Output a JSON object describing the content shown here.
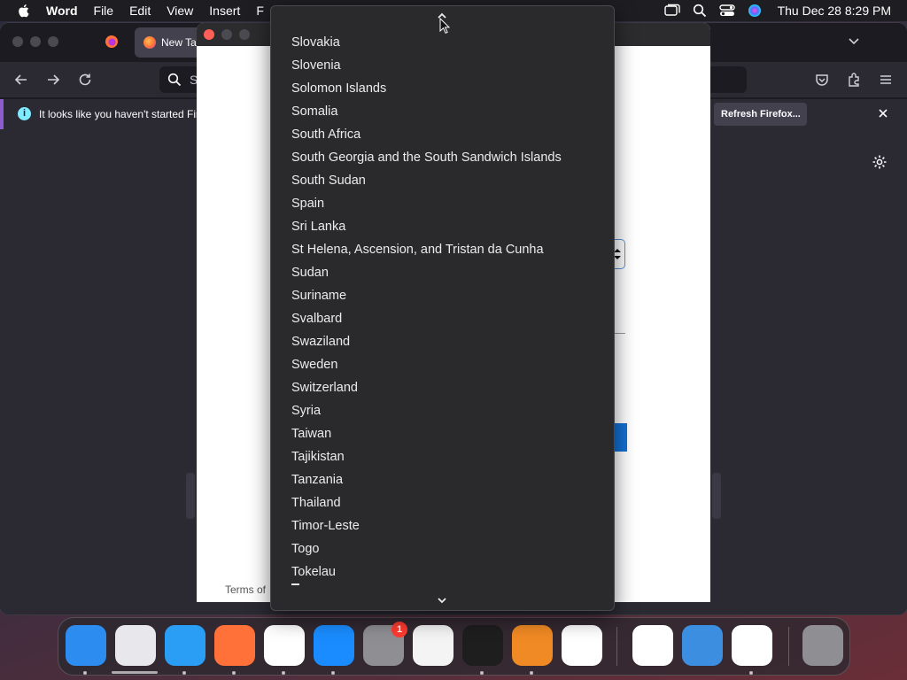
{
  "menubar": {
    "app_name": "Word",
    "items": [
      "File",
      "Edit",
      "View",
      "Insert",
      "F"
    ],
    "clock": "Thu Dec 28  8:29 PM"
  },
  "firefox": {
    "tab_title": "New Ta",
    "url_text": "S",
    "notification": "It looks like you haven't started Fir",
    "refresh_button": "Refresh Firefox..."
  },
  "word": {
    "terms_text": "Terms of"
  },
  "dropdown": {
    "items": [
      "Slovakia",
      "Slovenia",
      "Solomon Islands",
      "Somalia",
      "South Africa",
      "South Georgia and the South Sandwich Islands",
      "South Sudan",
      "Spain",
      "Sri Lanka",
      "St Helena, Ascension, and Tristan da Cunha",
      "Sudan",
      "Suriname",
      "Svalbard",
      "Swaziland",
      "Sweden",
      "Switzerland",
      "Syria",
      "Taiwan",
      "Tajikistan",
      "Tanzania",
      "Thailand",
      "Timor-Leste",
      "Togo",
      "Tokelau"
    ]
  },
  "dock": {
    "apps": [
      {
        "name": "finder-icon",
        "color": "#2d8cf0"
      },
      {
        "name": "launchpad-icon",
        "color": "#e7e7ec"
      },
      {
        "name": "safari-icon",
        "color": "#2a9df4"
      },
      {
        "name": "firefox-icon",
        "color": "#ff7139"
      },
      {
        "name": "chrome-icon",
        "color": "#ffffff"
      },
      {
        "name": "app-store-icon",
        "color": "#1a8cff"
      },
      {
        "name": "system-settings-icon",
        "color": "#8e8e93"
      },
      {
        "name": "textedit-icon",
        "color": "#f4f4f4"
      },
      {
        "name": "terminal-icon",
        "color": "#1e1e1e"
      },
      {
        "name": "garageband-icon",
        "color": "#f08a24"
      },
      {
        "name": "vscode-icon",
        "color": "#ffffff"
      },
      {
        "name": "visual-studio-icon",
        "color": "#ffffff"
      },
      {
        "name": "weather-icon",
        "color": "#3b8ee0"
      },
      {
        "name": "word-icon",
        "color": "#ffffff"
      },
      {
        "name": "trash-icon",
        "color": "#8e8e93"
      }
    ],
    "settings_badge": "1"
  },
  "colors": {
    "dropdown_bg": "#2a2a2c",
    "firefox_bg": "#2b2a33",
    "accent_blue": "#1470d6"
  }
}
